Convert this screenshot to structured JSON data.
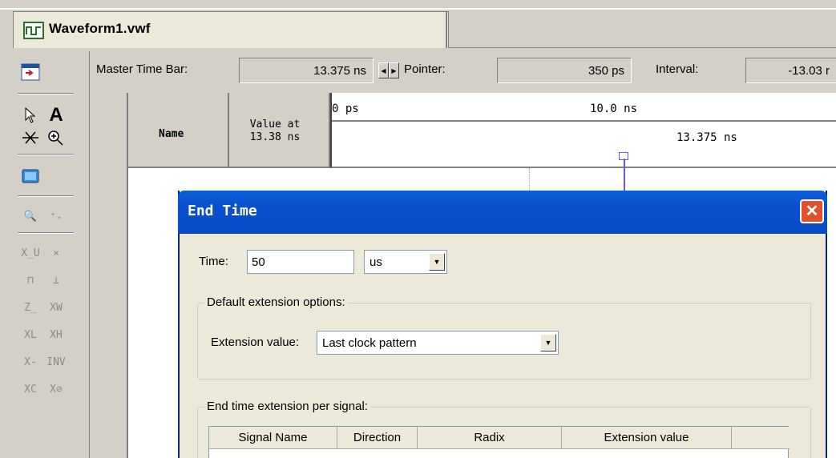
{
  "tab": {
    "title": "Waveform1.vwf"
  },
  "timebar": {
    "master_label": "Master Time Bar:",
    "master_value": "13.375 ns",
    "pointer_label": "Pointer:",
    "pointer_value": "350 ps",
    "interval_label": "Interval:",
    "interval_value": "-13.03 r"
  },
  "grid": {
    "name_header": "Name",
    "value_header_line1": "Value at",
    "value_header_line2": "13.38 ns",
    "ticks": [
      "0 ps",
      "10.0 ns"
    ],
    "cursor_label": "13.375 ns"
  },
  "dialog": {
    "title": "End Time",
    "time_label": "Time:",
    "time_value": "50",
    "unit_value": "us",
    "default_group_label": "Default extension options:",
    "extension_label": "Extension value:",
    "extension_value": "Last clock pattern",
    "per_signal_group_label": "End time extension per signal:",
    "table_headers": [
      "Signal Name",
      "Direction",
      "Radix",
      "Extension value"
    ]
  },
  "colors": {
    "titlebar": "#0a4ed0",
    "close": "#e0502a",
    "cursor": "#6a5acd"
  }
}
